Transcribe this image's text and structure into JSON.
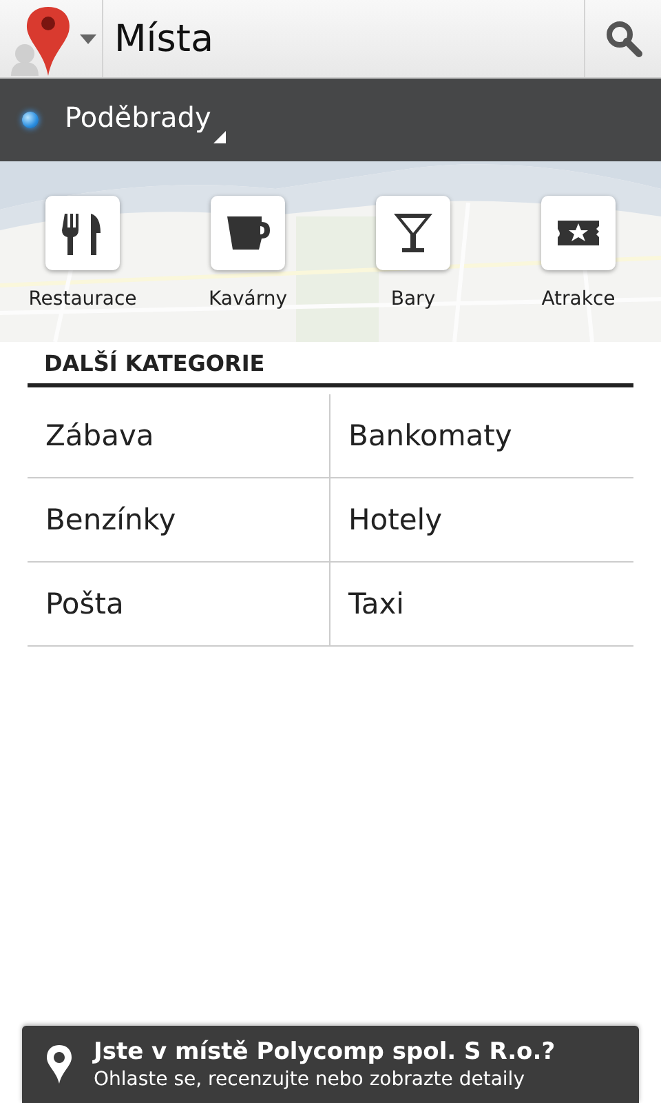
{
  "app_bar": {
    "title": "Místa"
  },
  "location": {
    "name": "Poděbrady"
  },
  "quick_categories": [
    {
      "kind": "restaurant",
      "label": "Restaurace"
    },
    {
      "kind": "cafe",
      "label": "Kavárny"
    },
    {
      "kind": "bar",
      "label": "Bary"
    },
    {
      "kind": "attraction",
      "label": "Atrakce"
    }
  ],
  "more_categories": {
    "heading": "DALŠÍ KATEGORIE",
    "items": [
      "Zábava",
      "Bankomaty",
      "Benzínky",
      "Hotely",
      "Pošta",
      "Taxi"
    ]
  },
  "check_in_banner": {
    "title": "Jste v místě Polycomp spol. S R.o.?",
    "subtitle": "Ohlaste se, recenzujte nebo zobrazte detaily"
  }
}
